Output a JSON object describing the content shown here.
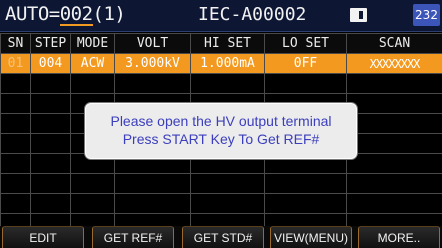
{
  "status": {
    "auto_label": "AUTO",
    "auto_sep": "=",
    "auto_number": "002",
    "auto_suffix": "(1)",
    "file_name": "IEC-A00002",
    "counter": "232"
  },
  "table": {
    "headers": [
      "SN",
      "STEP",
      "MODE",
      "VOLT",
      "HI SET",
      "LO SET",
      "SCAN"
    ],
    "rows": [
      {
        "sn": "01",
        "step": "004",
        "mode": "ACW",
        "volt": "3.000kV",
        "hi_set": "1.000mA",
        "lo_set": "0FF",
        "scan": "XXXXXXXX"
      }
    ]
  },
  "dialog": {
    "line1": "Please open the HV output terminal",
    "line2": "Press START Key To Get REF#"
  },
  "softkeys": [
    "EDIT",
    "GET REF#",
    "GET STD#",
    "VIEW(MENU)",
    "MORE.."
  ],
  "colors": {
    "accent": "#f4991f",
    "status_bar": "#0d1734",
    "badge": "#3c55b8",
    "dialog_text": "#3b3ebd"
  },
  "icons": {
    "file_icon": "file-icon"
  }
}
